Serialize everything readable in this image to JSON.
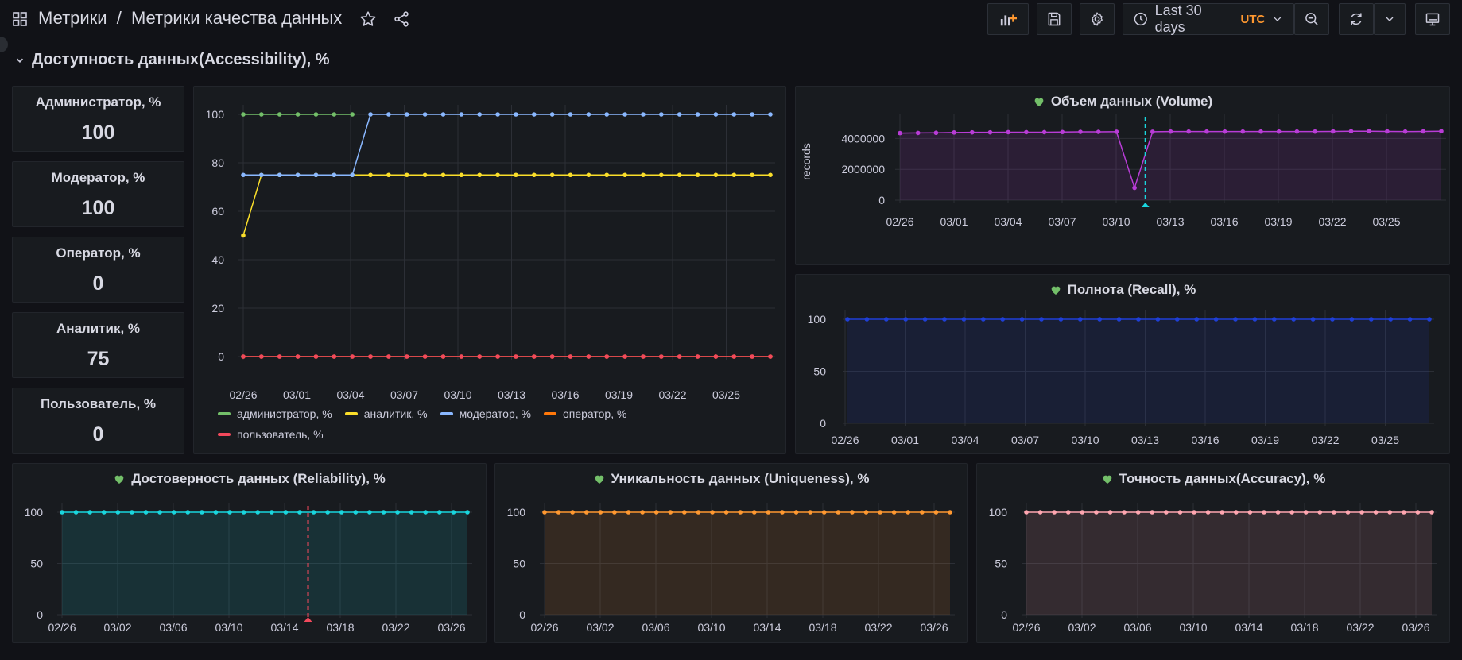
{
  "header": {
    "folder": "Метрики",
    "separator": "/",
    "dashboard_title": "Метрики качества данных",
    "time_range_label": "Last 30 days",
    "timezone": "UTC",
    "icons": [
      "apps-icon",
      "star-icon",
      "share-icon",
      "add-panel-icon",
      "save-icon",
      "settings-icon",
      "clock-icon",
      "chevron-down-icon",
      "zoom-out-icon",
      "refresh-icon",
      "chevron-down-icon",
      "tv-mode-icon"
    ]
  },
  "row": {
    "title": "Доступность данных(Accessibility), %"
  },
  "stats": [
    {
      "title": "Администратор, %",
      "value": "100"
    },
    {
      "title": "Модератор, %",
      "value": "100"
    },
    {
      "title": "Оператор, %",
      "value": "0"
    },
    {
      "title": "Аналитик, %",
      "value": "75"
    },
    {
      "title": "Пользователь, %",
      "value": "0"
    }
  ],
  "colors": {
    "admin": "#73bf69",
    "analyst": "#fade2a",
    "moderator": "#8ab8ff",
    "operator": "#ff780a",
    "user": "#f2495c",
    "volume": "#b83cd6",
    "recall": "#1f3fd6",
    "reliability": "#19d6de",
    "uniqueness": "#ff9830",
    "accuracy": "#ffa6b0",
    "health_ok": "#73bf69",
    "annotation_red": "#f2495c",
    "annotation_cyan": "#19d6de"
  },
  "chart_data": [
    {
      "id": "accessibility",
      "type": "line",
      "title": "",
      "ylim": [
        0,
        100
      ],
      "yticks": [
        "0",
        "20",
        "40",
        "60",
        "80",
        "100"
      ],
      "xticks": [
        "02/26",
        "03/01",
        "03/04",
        "03/07",
        "03/10",
        "03/13",
        "03/16",
        "03/19",
        "03/22",
        "03/25"
      ],
      "legend": "bottom",
      "series": [
        {
          "name": "администратор, %",
          "color": "#73bf69",
          "start": 0,
          "values": [
            100,
            100,
            100,
            100,
            100,
            100,
            100
          ]
        },
        {
          "name": "аналитик, %",
          "color": "#fade2a",
          "start": 0,
          "values": [
            50,
            75,
            75,
            75,
            75,
            75,
            75,
            75,
            75,
            75,
            75,
            75,
            75,
            75,
            75,
            75,
            75,
            75,
            75,
            75,
            75,
            75,
            75,
            75,
            75,
            75,
            75,
            75,
            75,
            75
          ]
        },
        {
          "name": "модератор, %",
          "color": "#8ab8ff",
          "start": 0,
          "values": [
            75,
            75,
            75,
            75,
            75,
            75,
            75,
            100,
            100,
            100,
            100,
            100,
            100,
            100,
            100,
            100,
            100,
            100,
            100,
            100,
            100,
            100,
            100,
            100,
            100,
            100,
            100,
            100,
            100,
            100
          ]
        },
        {
          "name": "оператор, %",
          "color": "#ff780a",
          "start": 0,
          "values": [
            0,
            0,
            0,
            0,
            0,
            0,
            0,
            0,
            0,
            0,
            0,
            0,
            0,
            0,
            0,
            0,
            0,
            0,
            0,
            0,
            0,
            0,
            0,
            0,
            0,
            0,
            0,
            0,
            0,
            0
          ]
        },
        {
          "name": "пользователь, %",
          "color": "#f2495c",
          "start": 0,
          "values": [
            0,
            0,
            0,
            0,
            0,
            0,
            0,
            0,
            0,
            0,
            0,
            0,
            0,
            0,
            0,
            0,
            0,
            0,
            0,
            0,
            0,
            0,
            0,
            0,
            0,
            0,
            0,
            0,
            0,
            0
          ]
        }
      ]
    },
    {
      "id": "volume",
      "type": "area",
      "title": "Объем данных (Volume)",
      "ylabel": "records",
      "ylim": [
        0,
        5000000
      ],
      "yticks": [
        "0",
        "2000000",
        "4000000"
      ],
      "ytick_values": [
        0,
        2000000,
        4000000
      ],
      "xticks": [
        "02/26",
        "03/01",
        "03/04",
        "03/07",
        "03/10",
        "03/13",
        "03/16",
        "03/19",
        "03/22",
        "03/25"
      ],
      "annotation": {
        "color": "#19d6de",
        "index": 13.6
      },
      "series": [
        {
          "name": "",
          "color": "#b83cd6",
          "values": [
            4350000,
            4360000,
            4370000,
            4390000,
            4400000,
            4400000,
            4410000,
            4410000,
            4410000,
            4420000,
            4430000,
            4430000,
            4440000,
            800000,
            4440000,
            4450000,
            4450000,
            4450000,
            4450000,
            4450000,
            4450000,
            4450000,
            4450000,
            4450000,
            4460000,
            4470000,
            4470000,
            4460000,
            4450000,
            4460000,
            4470000
          ]
        }
      ]
    },
    {
      "id": "recall",
      "type": "area",
      "title": "Полнота (Recall), %",
      "ylim": [
        0,
        100
      ],
      "yticks": [
        "0",
        "50",
        "100"
      ],
      "ytick_values": [
        0,
        50,
        100
      ],
      "xticks": [
        "02/26",
        "03/01",
        "03/04",
        "03/07",
        "03/10",
        "03/13",
        "03/16",
        "03/19",
        "03/22",
        "03/25"
      ],
      "series": [
        {
          "name": "",
          "color": "#1f3fd6",
          "values": [
            100,
            100,
            100,
            100,
            100,
            100,
            100,
            100,
            100,
            100,
            100,
            100,
            100,
            100,
            100,
            100,
            100,
            100,
            100,
            100,
            100,
            100,
            100,
            100,
            100,
            100,
            100,
            100,
            100,
            100,
            100
          ]
        }
      ]
    },
    {
      "id": "reliability",
      "type": "area",
      "title": "Достоверность данных (Reliability), %",
      "ylim": [
        0,
        100
      ],
      "yticks": [
        "0",
        "50",
        "100"
      ],
      "ytick_values": [
        0,
        50,
        100
      ],
      "xticks": [
        "02/26",
        "03/02",
        "03/06",
        "03/10",
        "03/14",
        "03/18",
        "03/22",
        "03/26"
      ],
      "annotation": {
        "color": "#f2495c",
        "index": 17.6
      },
      "series": [
        {
          "name": "",
          "color": "#19d6de",
          "values": [
            100,
            100,
            100,
            100,
            100,
            100,
            100,
            100,
            100,
            100,
            100,
            100,
            100,
            100,
            100,
            100,
            100,
            100,
            100,
            100,
            100,
            100,
            100,
            100,
            100,
            100,
            100,
            100,
            100,
            100
          ]
        }
      ]
    },
    {
      "id": "uniqueness",
      "type": "area",
      "title": "Уникальность данных (Uniqueness), %",
      "ylim": [
        0,
        100
      ],
      "yticks": [
        "0",
        "50",
        "100"
      ],
      "ytick_values": [
        0,
        50,
        100
      ],
      "xticks": [
        "02/26",
        "03/02",
        "03/06",
        "03/10",
        "03/14",
        "03/18",
        "03/22",
        "03/26"
      ],
      "series": [
        {
          "name": "",
          "color": "#ff9830",
          "values": [
            100,
            100,
            100,
            100,
            100,
            100,
            100,
            100,
            100,
            100,
            100,
            100,
            100,
            100,
            100,
            100,
            100,
            100,
            100,
            100,
            100,
            100,
            100,
            100,
            100,
            100,
            100,
            100,
            100,
            100
          ]
        }
      ]
    },
    {
      "id": "accuracy",
      "type": "area",
      "title": "Точность данных(Accuracy), %",
      "ylim": [
        0,
        100
      ],
      "yticks": [
        "0",
        "50",
        "100"
      ],
      "ytick_values": [
        0,
        50,
        100
      ],
      "xticks": [
        "02/26",
        "03/02",
        "03/06",
        "03/10",
        "03/14",
        "03/18",
        "03/22",
        "03/26"
      ],
      "series": [
        {
          "name": "",
          "color": "#ffa6b0",
          "values": [
            100,
            100,
            100,
            100,
            100,
            100,
            100,
            100,
            100,
            100,
            100,
            100,
            100,
            100,
            100,
            100,
            100,
            100,
            100,
            100,
            100,
            100,
            100,
            100,
            100,
            100,
            100,
            100,
            100,
            100
          ]
        }
      ]
    }
  ]
}
